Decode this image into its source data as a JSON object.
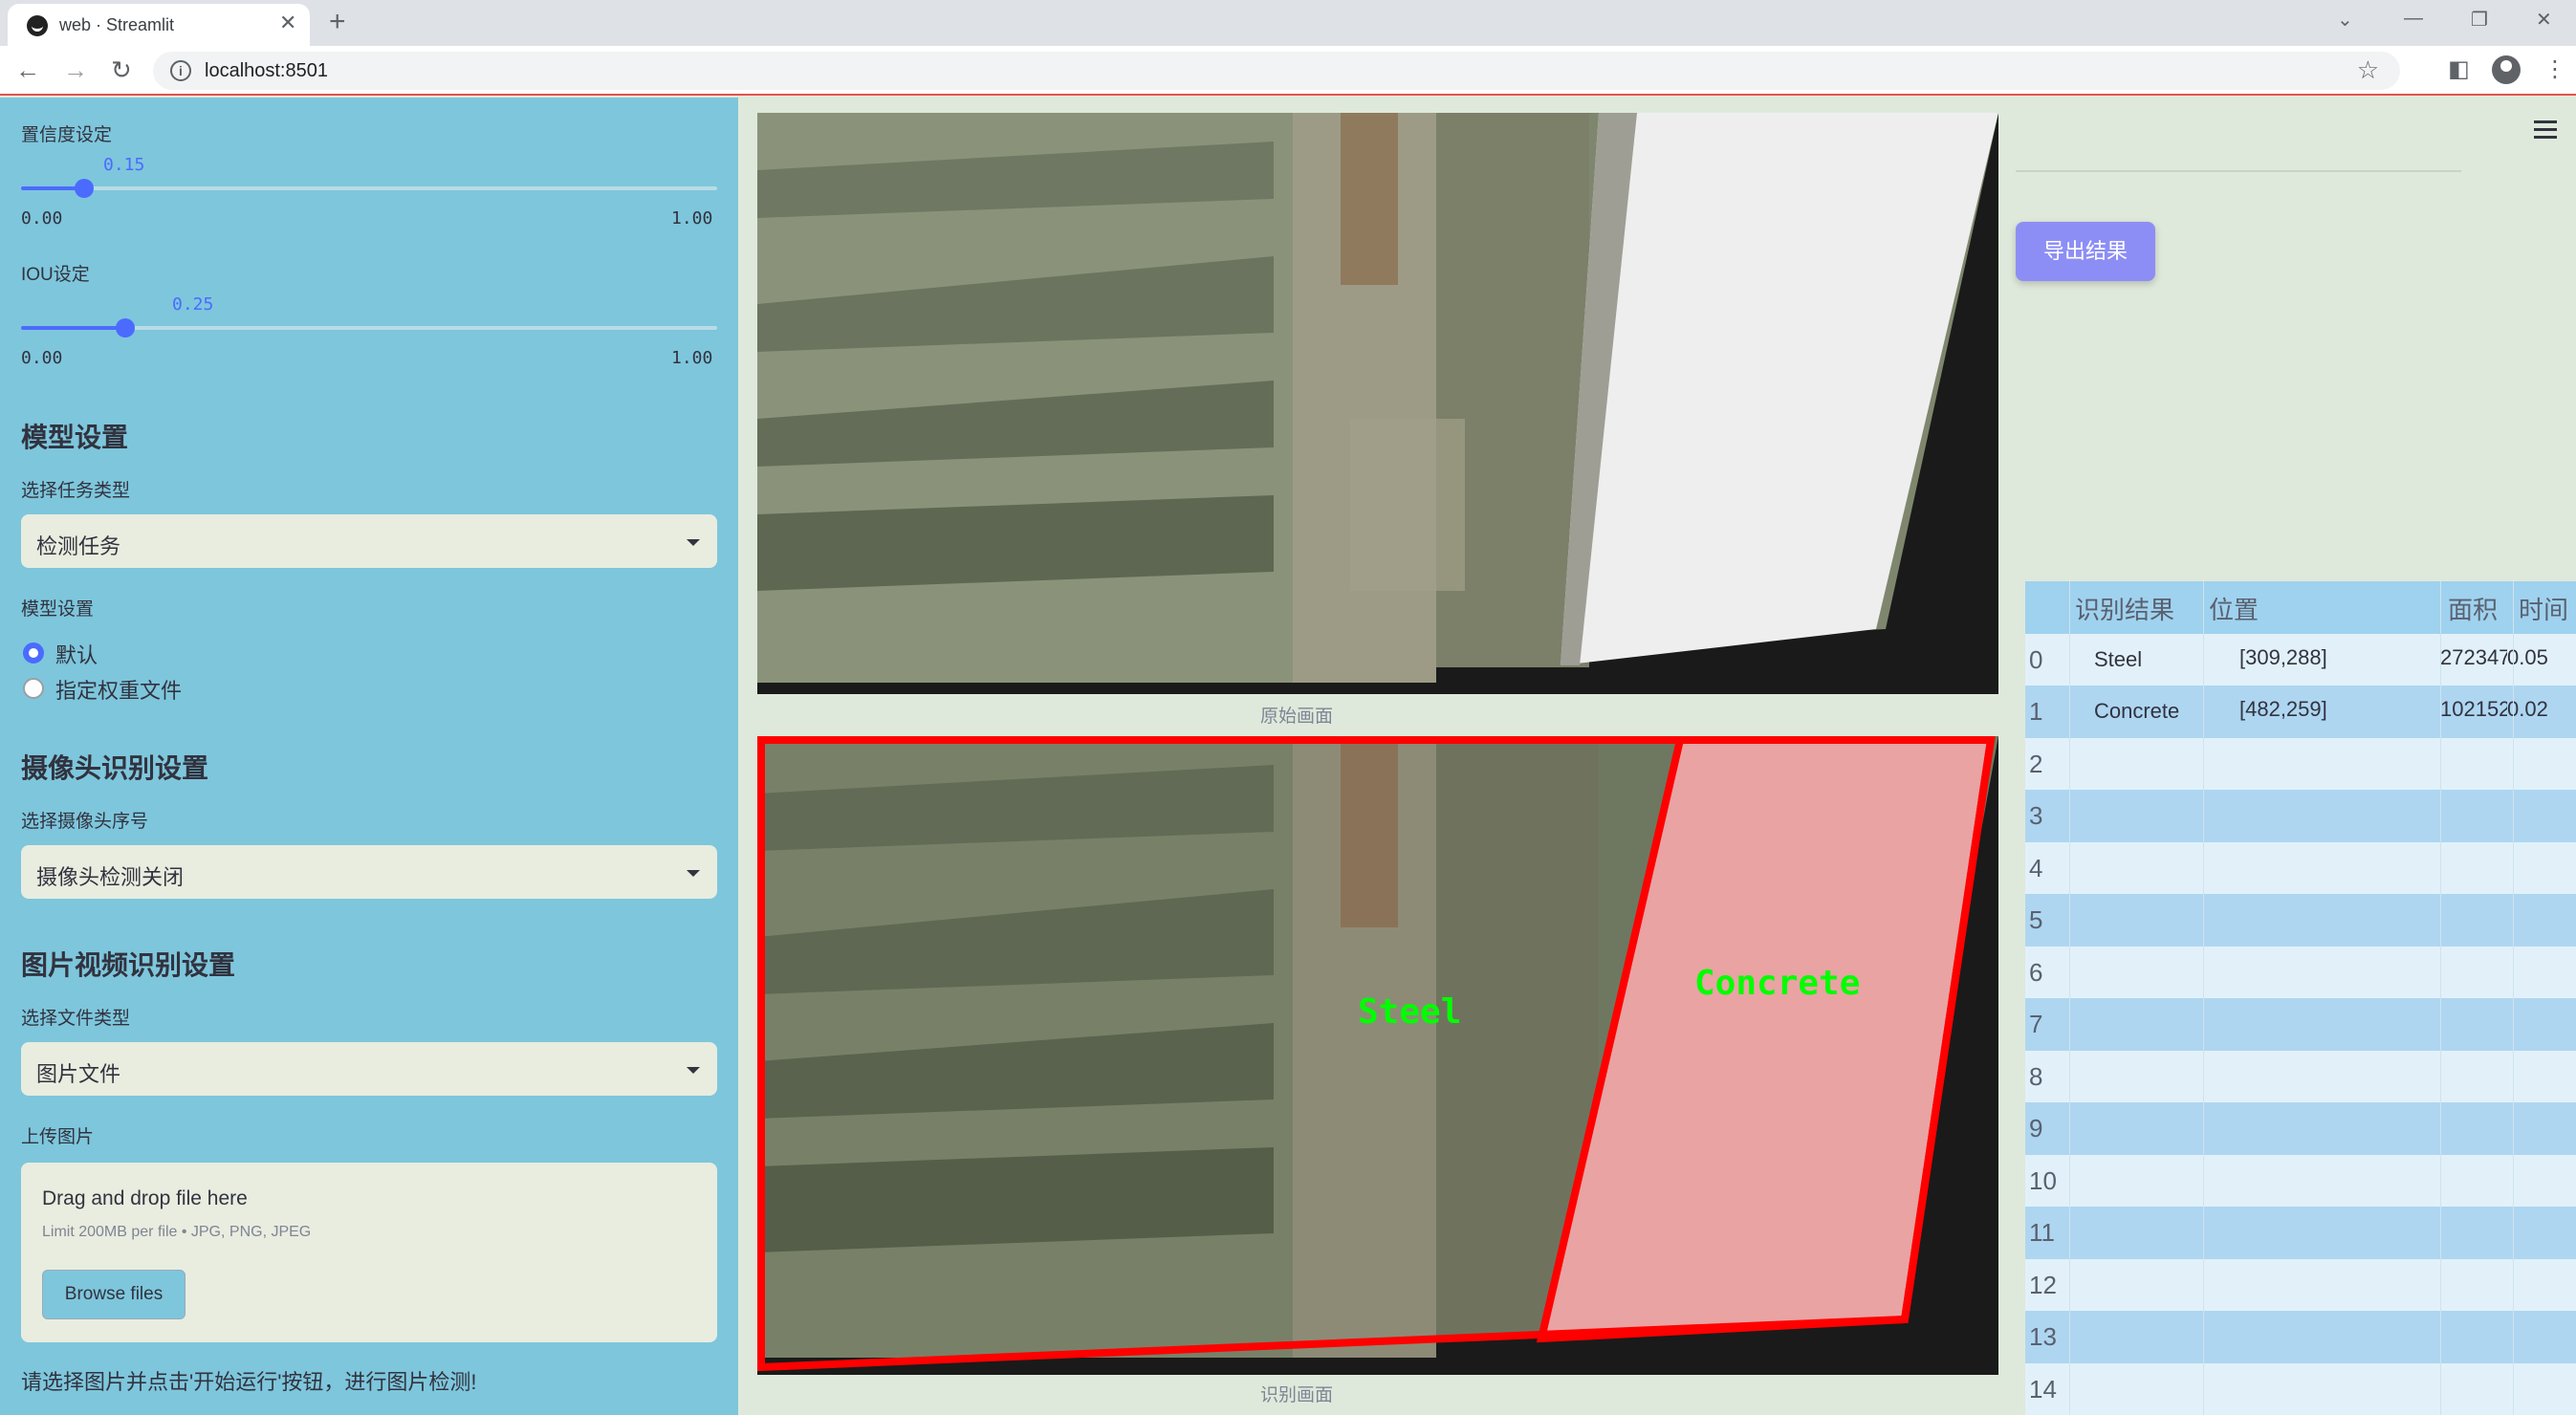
{
  "browser": {
    "tab_title": "web · Streamlit",
    "url": "localhost:8501"
  },
  "sidebar": {
    "confidence": {
      "label": "置信度设定",
      "value": "0.15",
      "min": "0.00",
      "max": "1.00",
      "fraction": 0.15
    },
    "iou": {
      "label": "IOU设定",
      "value": "0.25",
      "min": "0.00",
      "max": "1.00",
      "fraction": 0.25
    },
    "model_section": "模型设置",
    "task_label": "选择任务类型",
    "task_value": "检测任务",
    "model_label": "模型设置",
    "model_options": [
      "默认",
      "指定权重文件"
    ],
    "model_selected": 0,
    "camera_section": "摄像头识别设置",
    "camera_label": "选择摄像头序号",
    "camera_value": "摄像头检测关闭",
    "media_section": "图片视频识别设置",
    "filetype_label": "选择文件类型",
    "filetype_value": "图片文件",
    "upload_label": "上传图片",
    "upload_title": "Drag and drop file here",
    "upload_limit": "Limit 200MB per file • JPG, PNG, JPEG",
    "browse_label": "Browse files",
    "hint": "请选择图片并点击'开始运行'按钮，进行图片检测!"
  },
  "main": {
    "original_caption": "原始画面",
    "result_caption": "识别画面",
    "detections": [
      {
        "label": "Steel",
        "color": "#00ff00"
      },
      {
        "label": "Concrete",
        "color": "#00ff00"
      }
    ],
    "box_color": "#ff0000"
  },
  "results": {
    "export_label": "导出结果",
    "columns": [
      "识别结果",
      "位置",
      "面积",
      "时间"
    ],
    "rows": [
      {
        "idx": "0",
        "label": "Steel",
        "pos": "[309,288]",
        "area": "272347",
        "time": "0.05"
      },
      {
        "idx": "1",
        "label": "Concrete",
        "pos": "[482,259]",
        "area": "102152",
        "time": "0.02"
      },
      {
        "idx": "2"
      },
      {
        "idx": "3"
      },
      {
        "idx": "4"
      },
      {
        "idx": "5"
      },
      {
        "idx": "6"
      },
      {
        "idx": "7"
      },
      {
        "idx": "8"
      },
      {
        "idx": "9"
      },
      {
        "idx": "10"
      },
      {
        "idx": "11"
      },
      {
        "idx": "12"
      },
      {
        "idx": "13"
      },
      {
        "idx": "14"
      }
    ]
  }
}
